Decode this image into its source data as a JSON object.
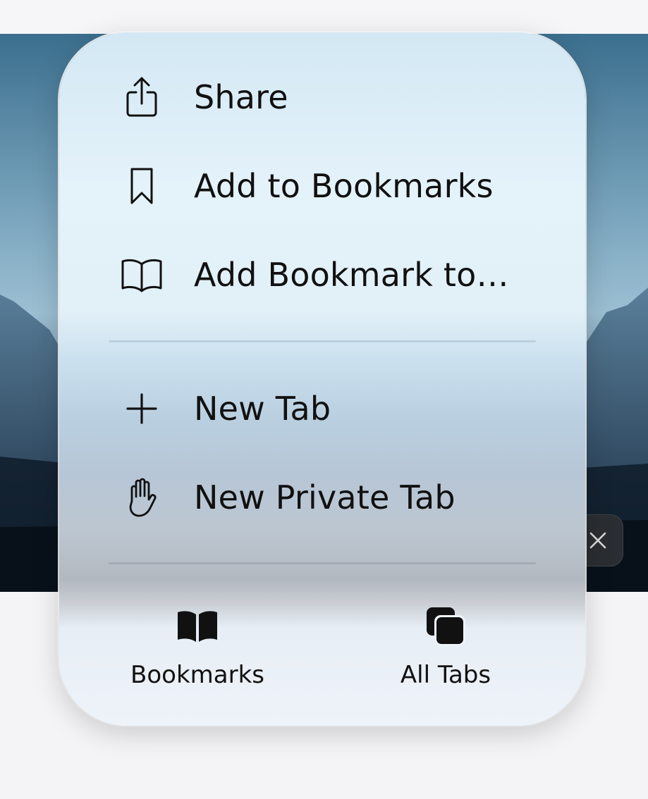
{
  "menu": {
    "items": [
      {
        "label": "Share",
        "icon": "share-icon"
      },
      {
        "label": "Add to Bookmarks",
        "icon": "bookmark-icon"
      },
      {
        "label": "Add Bookmark to…",
        "icon": "open-book-icon"
      },
      {
        "label": "New Tab",
        "icon": "plus-icon"
      },
      {
        "label": "New Private Tab",
        "icon": "hand-icon"
      }
    ],
    "footer": [
      {
        "label": "Bookmarks",
        "icon": "bookmarks-book-icon"
      },
      {
        "label": "All Tabs",
        "icon": "all-tabs-icon"
      }
    ]
  },
  "background": {
    "close_icon": "close-icon"
  },
  "colors": {
    "text": "#111111",
    "divider": "#b8c6d2"
  }
}
